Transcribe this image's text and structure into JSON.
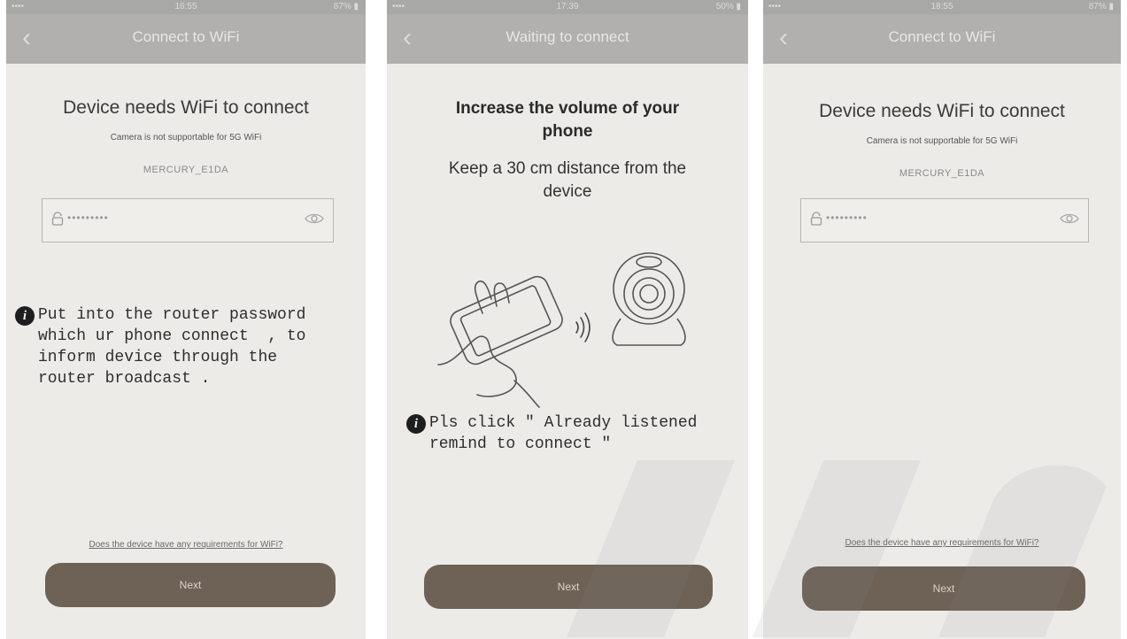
{
  "screens": [
    {
      "status": {
        "left": "•••• ",
        "center": "16:55",
        "right": "87% ▮"
      },
      "nav": {
        "back": "‹",
        "title": "Connect to WiFi"
      },
      "heading": "Device needs WiFi to connect",
      "subtitle": "Camera is not supportable for 5G WiFi",
      "ssid": "MERCURY_E1DA",
      "password_mask": "•••••••••",
      "note": "Put into the router password\nwhich ur phone connect  , to\ninform device through the\nrouter broadcast .",
      "link": "Does the device have any requirements for WiFi?",
      "button": "Next"
    },
    {
      "status": {
        "left": "•••• ",
        "center": "17:39",
        "right": "50% ▮"
      },
      "nav": {
        "back": "‹",
        "title": "Waiting to connect"
      },
      "heading": "Increase the volume of your\nphone",
      "heading2": "Keep a 30 cm distance from the\ndevice",
      "note": "Pls click \" Already listened\nremind to connect \"",
      "button": "Next"
    },
    {
      "status": {
        "left": "•••• ",
        "center": "18:55",
        "right": "87% ▮"
      },
      "nav": {
        "back": "‹",
        "title": "Connect to WiFi"
      },
      "heading": "Device needs WiFi to connect",
      "subtitle": "Camera is not supportable for 5G WiFi",
      "ssid": "MERCURY_E1DA",
      "password_mask": "•••••••••",
      "link": "Does the device have any requirements for WiFi?",
      "button": "Next"
    }
  ],
  "colors": {
    "navbar": "#b1b0ae",
    "button": "#6e6257",
    "background": "#ecebe8"
  },
  "icons": [
    "back-chevron-icon",
    "lock-icon",
    "eye-icon",
    "info-icon",
    "sound-wave-icon"
  ]
}
